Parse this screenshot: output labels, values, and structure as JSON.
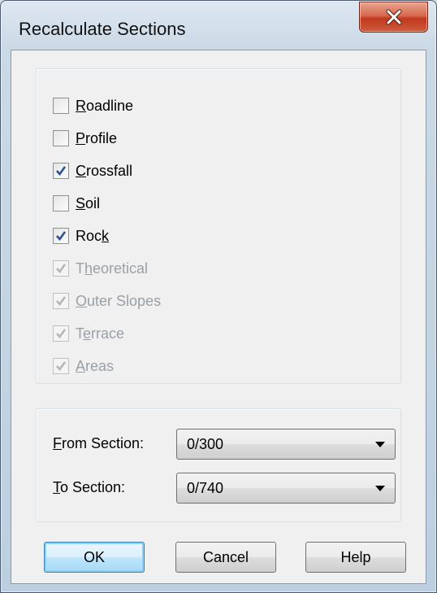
{
  "window": {
    "title": "Recalculate Sections"
  },
  "checkboxes": [
    {
      "label_pre": "",
      "label_u": "R",
      "label_post": "oadline",
      "checked": false,
      "disabled": false
    },
    {
      "label_pre": "",
      "label_u": "P",
      "label_post": "rofile",
      "checked": false,
      "disabled": false
    },
    {
      "label_pre": "",
      "label_u": "C",
      "label_post": "rossfall",
      "checked": true,
      "disabled": false
    },
    {
      "label_pre": "",
      "label_u": "S",
      "label_post": "oil",
      "checked": false,
      "disabled": false
    },
    {
      "label_pre": "Roc",
      "label_u": "k",
      "label_post": "",
      "checked": true,
      "disabled": false
    },
    {
      "label_pre": "T",
      "label_u": "h",
      "label_post": "eoretical",
      "checked": true,
      "disabled": true
    },
    {
      "label_pre": "",
      "label_u": "O",
      "label_post": "uter Slopes",
      "checked": true,
      "disabled": true
    },
    {
      "label_pre": "T",
      "label_u": "e",
      "label_post": "rrace",
      "checked": true,
      "disabled": true
    },
    {
      "label_pre": "",
      "label_u": "A",
      "label_post": "reas",
      "checked": true,
      "disabled": true
    }
  ],
  "sections": {
    "from": {
      "label_u": "F",
      "label_post": "rom Section:",
      "value": "0/300"
    },
    "to": {
      "label_u": "T",
      "label_post": "o Section:",
      "value": "0/740"
    }
  },
  "buttons": {
    "ok": "OK",
    "cancel": "Cancel",
    "help": "Help"
  }
}
